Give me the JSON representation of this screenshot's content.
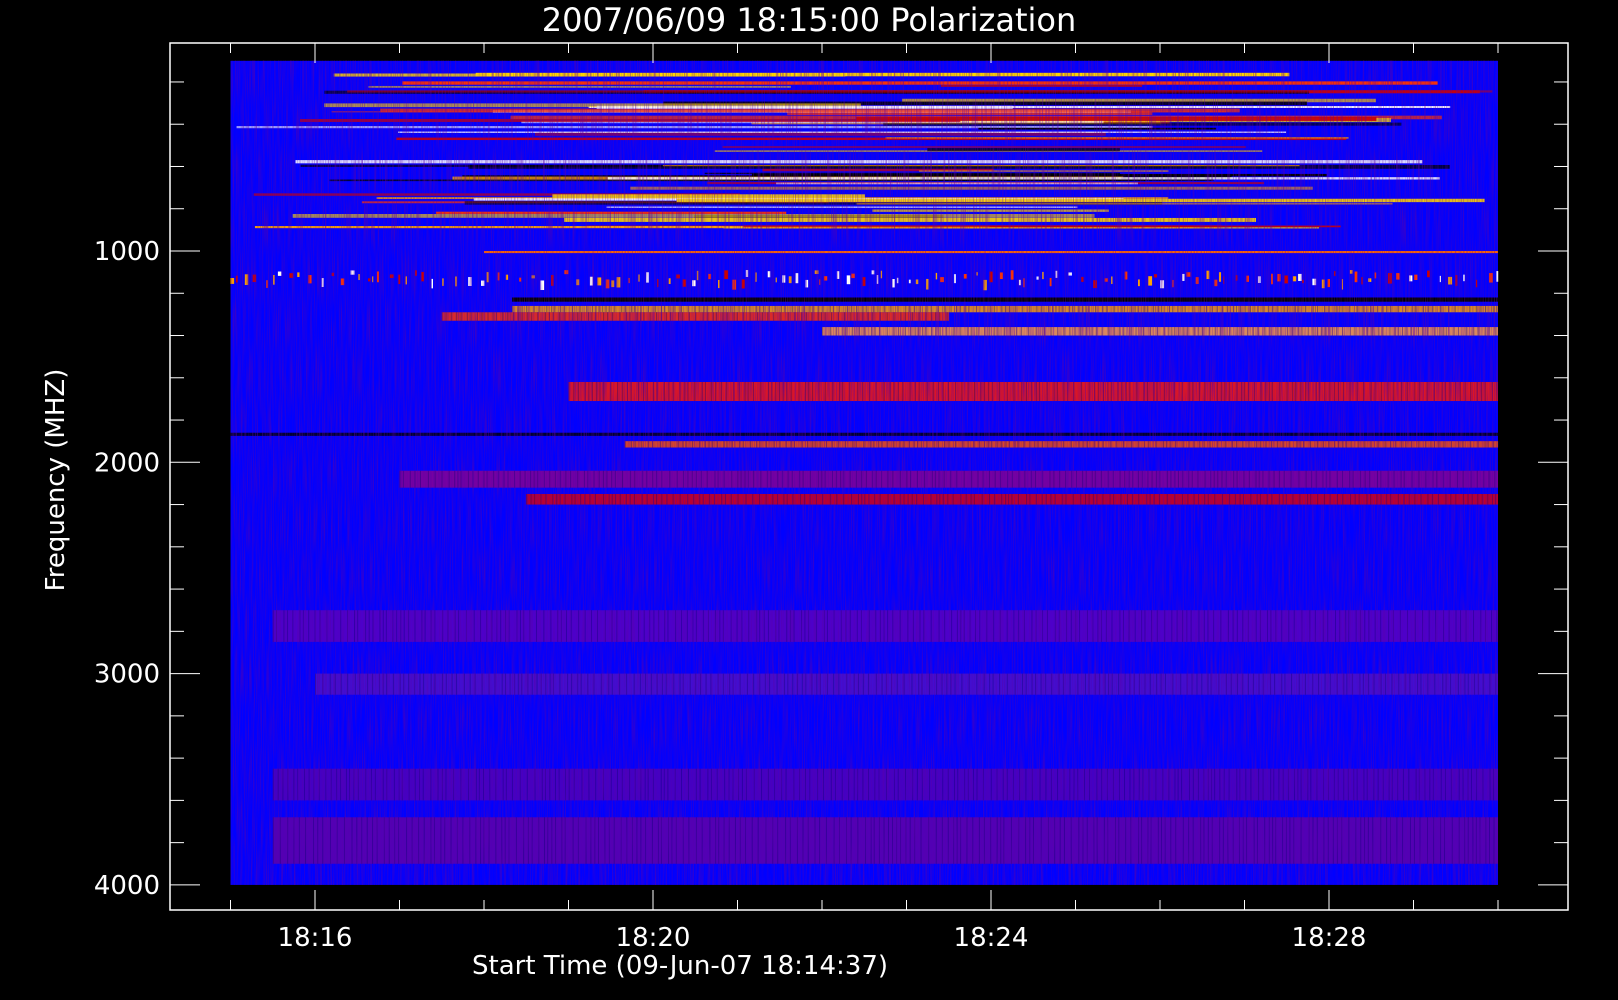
{
  "chart_data": {
    "type": "heatmap",
    "title": "2007/06/09 18:15:00 Polarization",
    "xlabel": "Start Time (09-Jun-07 18:14:37)",
    "ylabel": "Frequency (MHZ)",
    "x_axis": {
      "unit": "time",
      "range": [
        "18:14:00",
        "18:30:00"
      ],
      "data_extent": [
        "18:15:00",
        "18:30:00"
      ],
      "major_ticks": [
        "18:16",
        "18:20",
        "18:24",
        "18:28"
      ],
      "minor_tick_interval_min": 1
    },
    "y_axis": {
      "unit": "MHz",
      "range": [
        100,
        4100
      ],
      "data_extent": [
        100,
        4000
      ],
      "inverted": true,
      "major_ticks": [
        1000,
        2000,
        3000,
        4000
      ],
      "minor_tick_interval": 200
    },
    "background_color": "#0000ff",
    "colors": {
      "low": "#000000",
      "mid_low": "#1a1aff",
      "mid": "#cc0000",
      "high": "#ffa500",
      "max": "#ffffff"
    },
    "features": [
      {
        "freq_from": 150,
        "freq_to": 900,
        "t_from": "18:15:00",
        "t_to": "18:30:00",
        "pattern": "noisy-rfi",
        "color": "mixed"
      },
      {
        "freq_from": 1000,
        "freq_to": 1010,
        "t_from": "18:18:00",
        "t_to": "18:30:00",
        "pattern": "line",
        "color": "#ff6600"
      },
      {
        "freq_from": 1090,
        "freq_to": 1140,
        "t_from": "18:15:00",
        "t_to": "18:30:00",
        "pattern": "dashed",
        "color": "#ff8c00"
      },
      {
        "freq_from": 1220,
        "freq_to": 1240,
        "t_from": "18:18:20",
        "t_to": "18:30:00",
        "pattern": "line",
        "color": "#000000"
      },
      {
        "freq_from": 1260,
        "freq_to": 1290,
        "t_from": "18:18:20",
        "t_to": "18:30:00",
        "pattern": "band",
        "color": "#ffa500"
      },
      {
        "freq_from": 1290,
        "freq_to": 1330,
        "t_from": "18:17:30",
        "t_to": "18:23:30",
        "pattern": "band",
        "color": "#ff3300"
      },
      {
        "freq_from": 1360,
        "freq_to": 1400,
        "t_from": "18:22:00",
        "t_to": "18:30:00",
        "pattern": "band",
        "color": "#ffa040"
      },
      {
        "freq_from": 1620,
        "freq_to": 1710,
        "t_from": "18:19:00",
        "t_to": "18:30:00",
        "pattern": "band",
        "color": "#ff1a00"
      },
      {
        "freq_from": 1860,
        "freq_to": 1875,
        "t_from": "18:15:00",
        "t_to": "18:30:00",
        "pattern": "line",
        "color": "#000033"
      },
      {
        "freq_from": 1900,
        "freq_to": 1930,
        "t_from": "18:19:40",
        "t_to": "18:30:00",
        "pattern": "band",
        "color": "#ff5500"
      },
      {
        "freq_from": 2040,
        "freq_to": 2120,
        "t_from": "18:17:00",
        "t_to": "18:30:00",
        "pattern": "band",
        "color": "#8a0090"
      },
      {
        "freq_from": 2150,
        "freq_to": 2200,
        "t_from": "18:18:30",
        "t_to": "18:30:00",
        "pattern": "band",
        "color": "#e00000"
      },
      {
        "freq_from": 2700,
        "freq_to": 2850,
        "t_from": "18:15:30",
        "t_to": "18:30:00",
        "pattern": "band",
        "color": "#5a00c0"
      },
      {
        "freq_from": 3000,
        "freq_to": 3100,
        "t_from": "18:16:00",
        "t_to": "18:30:00",
        "pattern": "band",
        "color": "#4d10c8"
      },
      {
        "freq_from": 3450,
        "freq_to": 3600,
        "t_from": "18:15:30",
        "t_to": "18:30:00",
        "pattern": "band",
        "color": "#5000b8"
      },
      {
        "freq_from": 3680,
        "freq_to": 3900,
        "t_from": "18:15:30",
        "t_to": "18:30:00",
        "pattern": "band",
        "color": "#6000a8"
      }
    ],
    "grid": false,
    "legend": "none"
  }
}
